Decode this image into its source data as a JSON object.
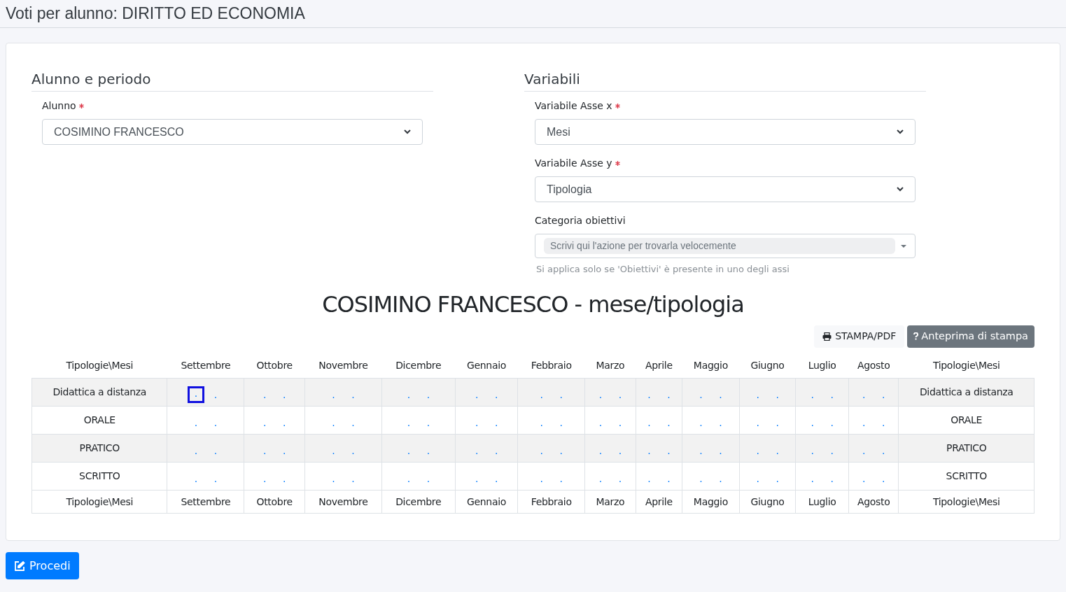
{
  "page_title": "Voti per alunno: DIRITTO ED ECONOMIA",
  "student_section": {
    "title": "Alunno e periodo",
    "fields": [
      {
        "label": "Alunno",
        "required": true,
        "value": "COSIMINO FRANCESCO"
      }
    ]
  },
  "variables_section": {
    "title": "Variabili",
    "fields": [
      {
        "label": "Variabile Asse x",
        "required": true,
        "value": "Mesi"
      },
      {
        "label": "Variabile Asse y",
        "required": true,
        "value": "Tipologia"
      }
    ],
    "category": {
      "label": "Categoria obiettivi",
      "placeholder": "Scrivi qui l'azione per trovarla velocemente",
      "hint": "Si applica solo se 'Obiettivi' è presente in uno degli assi"
    }
  },
  "report_title": "COSIMINO FRANCESCO - mese/tipologia",
  "actions": [
    {
      "kind": "print",
      "label": "STAMPA/PDF"
    },
    {
      "kind": "preview",
      "label": "Anteprima di stampa"
    }
  ],
  "table": {
    "columns": [
      "Tipologie\\Mesi",
      "Settembre",
      "Ottobre",
      "Novembre",
      "Dicembre",
      "Gennaio",
      "Febbraio",
      "Marzo",
      "Aprile",
      "Maggio",
      "Giugno",
      "Luglio",
      "Agosto",
      "Tipologie\\Mesi"
    ],
    "rows": [
      [
        {
          "kind": "label",
          "text": "Didattica a distanza"
        },
        {
          "kind": "grades",
          "marks": [
            ".",
            "."
          ],
          "focused": true
        },
        {
          "kind": "grades",
          "marks": [
            ".",
            "."
          ],
          "focused": false
        },
        {
          "kind": "grades",
          "marks": [
            ".",
            "."
          ],
          "focused": false
        },
        {
          "kind": "grades",
          "marks": [
            ".",
            "."
          ],
          "focused": false
        },
        {
          "kind": "grades",
          "marks": [
            ".",
            "."
          ],
          "focused": false
        },
        {
          "kind": "grades",
          "marks": [
            ".",
            "."
          ],
          "focused": false
        },
        {
          "kind": "grades",
          "marks": [
            ".",
            "."
          ],
          "focused": false
        },
        {
          "kind": "grades",
          "marks": [
            ".",
            "."
          ],
          "focused": false
        },
        {
          "kind": "grades",
          "marks": [
            ".",
            "."
          ],
          "focused": false
        },
        {
          "kind": "grades",
          "marks": [
            ".",
            "."
          ],
          "focused": false
        },
        {
          "kind": "grades",
          "marks": [
            ".",
            "."
          ],
          "focused": false
        },
        {
          "kind": "grades",
          "marks": [
            ".",
            "."
          ],
          "focused": false
        },
        {
          "kind": "label",
          "text": "Didattica a distanza"
        }
      ],
      [
        {
          "kind": "label",
          "text": "ORALE"
        },
        {
          "kind": "grades",
          "marks": [
            ".",
            "."
          ],
          "focused": false
        },
        {
          "kind": "grades",
          "marks": [
            ".",
            "."
          ],
          "focused": false
        },
        {
          "kind": "grades",
          "marks": [
            ".",
            "."
          ],
          "focused": false
        },
        {
          "kind": "grades",
          "marks": [
            ".",
            "."
          ],
          "focused": false
        },
        {
          "kind": "grades",
          "marks": [
            ".",
            "."
          ],
          "focused": false
        },
        {
          "kind": "grades",
          "marks": [
            ".",
            "."
          ],
          "focused": false
        },
        {
          "kind": "grades",
          "marks": [
            ".",
            "."
          ],
          "focused": false
        },
        {
          "kind": "grades",
          "marks": [
            ".",
            "."
          ],
          "focused": false
        },
        {
          "kind": "grades",
          "marks": [
            ".",
            "."
          ],
          "focused": false
        },
        {
          "kind": "grades",
          "marks": [
            ".",
            "."
          ],
          "focused": false
        },
        {
          "kind": "grades",
          "marks": [
            ".",
            "."
          ],
          "focused": false
        },
        {
          "kind": "grades",
          "marks": [
            ".",
            "."
          ],
          "focused": false
        },
        {
          "kind": "label",
          "text": "ORALE"
        }
      ],
      [
        {
          "kind": "label",
          "text": "PRATICO"
        },
        {
          "kind": "grades",
          "marks": [
            ".",
            "."
          ],
          "focused": false
        },
        {
          "kind": "grades",
          "marks": [
            ".",
            "."
          ],
          "focused": false
        },
        {
          "kind": "grades",
          "marks": [
            ".",
            "."
          ],
          "focused": false
        },
        {
          "kind": "grades",
          "marks": [
            ".",
            "."
          ],
          "focused": false
        },
        {
          "kind": "grades",
          "marks": [
            ".",
            "."
          ],
          "focused": false
        },
        {
          "kind": "grades",
          "marks": [
            ".",
            "."
          ],
          "focused": false
        },
        {
          "kind": "grades",
          "marks": [
            ".",
            "."
          ],
          "focused": false
        },
        {
          "kind": "grades",
          "marks": [
            ".",
            "."
          ],
          "focused": false
        },
        {
          "kind": "grades",
          "marks": [
            ".",
            "."
          ],
          "focused": false
        },
        {
          "kind": "grades",
          "marks": [
            ".",
            "."
          ],
          "focused": false
        },
        {
          "kind": "grades",
          "marks": [
            ".",
            "."
          ],
          "focused": false
        },
        {
          "kind": "grades",
          "marks": [
            ".",
            "."
          ],
          "focused": false
        },
        {
          "kind": "label",
          "text": "PRATICO"
        }
      ],
      [
        {
          "kind": "label",
          "text": "SCRITTO"
        },
        {
          "kind": "grades",
          "marks": [
            ".",
            "."
          ],
          "focused": false
        },
        {
          "kind": "grades",
          "marks": [
            ".",
            "."
          ],
          "focused": false
        },
        {
          "kind": "grades",
          "marks": [
            ".",
            "."
          ],
          "focused": false
        },
        {
          "kind": "grades",
          "marks": [
            ".",
            "."
          ],
          "focused": false
        },
        {
          "kind": "grades",
          "marks": [
            ".",
            "."
          ],
          "focused": false
        },
        {
          "kind": "grades",
          "marks": [
            ".",
            "."
          ],
          "focused": false
        },
        {
          "kind": "grades",
          "marks": [
            ".",
            "."
          ],
          "focused": false
        },
        {
          "kind": "grades",
          "marks": [
            ".",
            "."
          ],
          "focused": false
        },
        {
          "kind": "grades",
          "marks": [
            ".",
            "."
          ],
          "focused": false
        },
        {
          "kind": "grades",
          "marks": [
            ".",
            "."
          ],
          "focused": false
        },
        {
          "kind": "grades",
          "marks": [
            ".",
            "."
          ],
          "focused": false
        },
        {
          "kind": "grades",
          "marks": [
            ".",
            "."
          ],
          "focused": false
        },
        {
          "kind": "label",
          "text": "SCRITTO"
        }
      ],
      [
        {
          "kind": "label",
          "text": "Tipologie\\Mesi"
        },
        {
          "kind": "label",
          "text": "Settembre"
        },
        {
          "kind": "label",
          "text": "Ottobre"
        },
        {
          "kind": "label",
          "text": "Novembre"
        },
        {
          "kind": "label",
          "text": "Dicembre"
        },
        {
          "kind": "label",
          "text": "Gennaio"
        },
        {
          "kind": "label",
          "text": "Febbraio"
        },
        {
          "kind": "label",
          "text": "Marzo"
        },
        {
          "kind": "label",
          "text": "Aprile"
        },
        {
          "kind": "label",
          "text": "Maggio"
        },
        {
          "kind": "label",
          "text": "Giugno"
        },
        {
          "kind": "label",
          "text": "Luglio"
        },
        {
          "kind": "label",
          "text": "Agosto"
        },
        {
          "kind": "label",
          "text": "Tipologie\\Mesi"
        }
      ]
    ]
  },
  "submit_button": "Procedi"
}
